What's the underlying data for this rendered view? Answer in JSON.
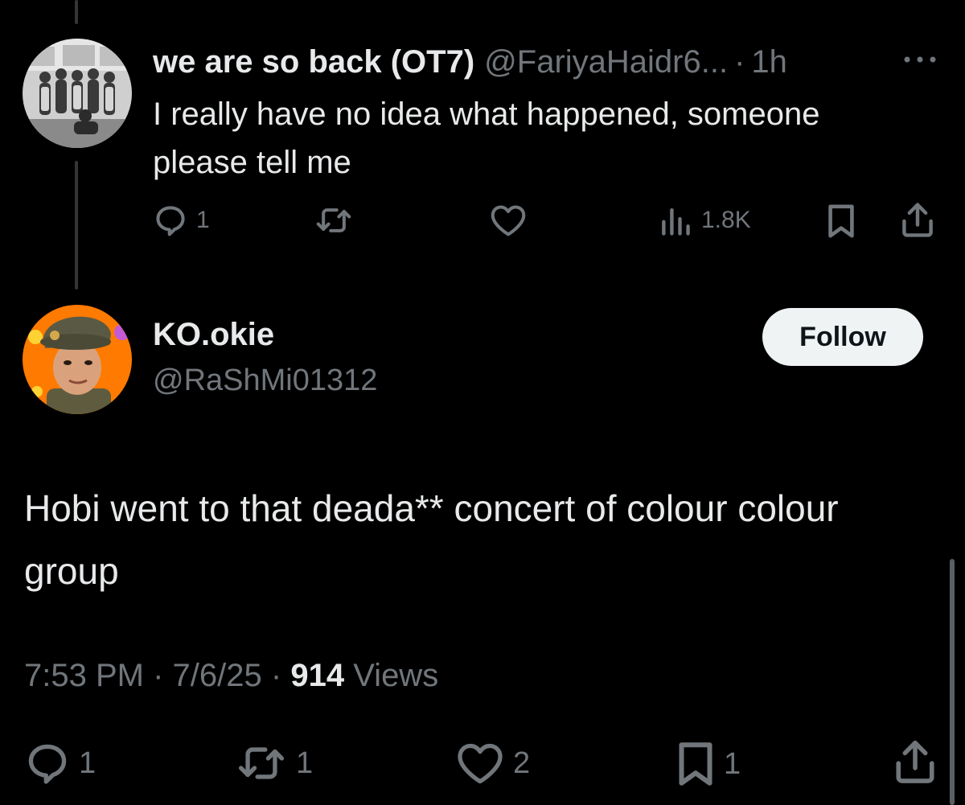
{
  "parent_tweet": {
    "display_name": "we are so back (OT7)",
    "handle": "@FariyaHaidr6...",
    "separator": "·",
    "time": "1h",
    "more_icon": "more-horizontal-icon",
    "text": "I really have no idea what happened, someone please tell me",
    "actions": {
      "reply_count": "1",
      "retweet_count": "",
      "like_count": "",
      "views_count": "1.8K"
    }
  },
  "main_tweet": {
    "display_name": "KO.okie",
    "handle": "@RaShMi01312",
    "follow_label": "Follow",
    "text": "Hobi went to that deada** concert of colour colour group",
    "time": "7:53 PM",
    "date": "7/6/25",
    "separator": "·",
    "views_count": "914",
    "views_label": "Views",
    "actions": {
      "reply_count": "1",
      "retweet_count": "1",
      "like_count": "2",
      "bookmark_count": "1"
    }
  },
  "colors": {
    "background": "#000000",
    "text_primary": "#e7e9ea",
    "text_secondary": "#71767b",
    "thread_line": "#333639",
    "follow_button_bg": "#eff3f4",
    "avatar_main_bg": "#ff7a00"
  }
}
